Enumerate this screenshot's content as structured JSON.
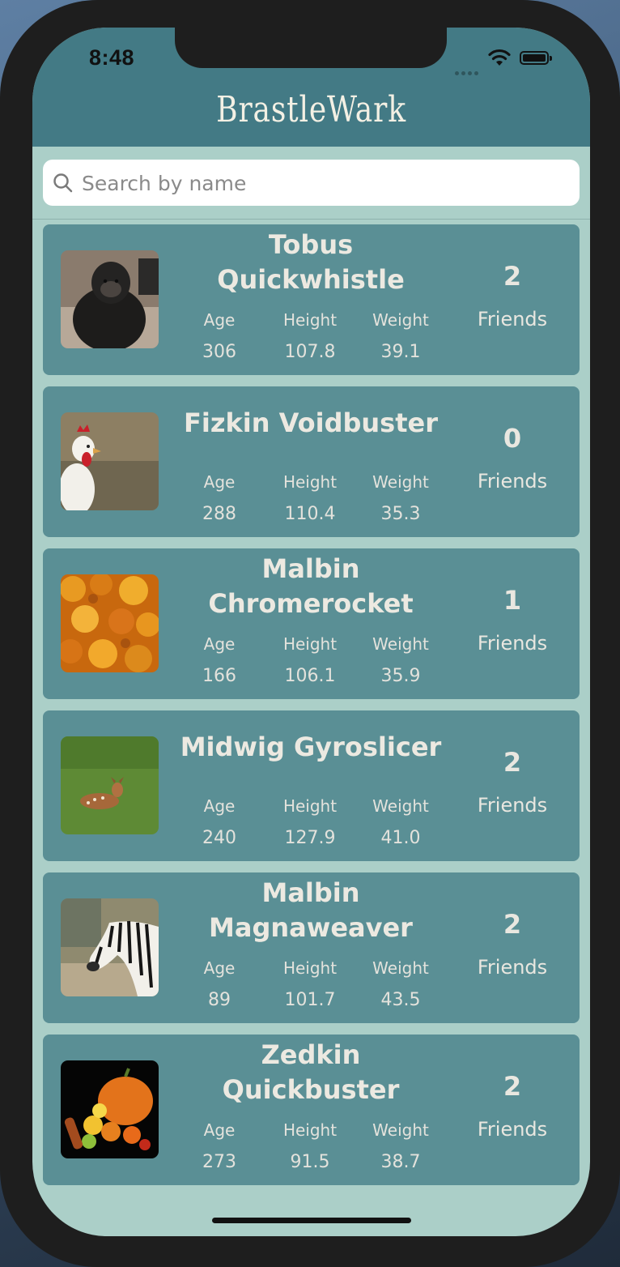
{
  "status_bar": {
    "time": "8:48"
  },
  "header": {
    "title": "BrastleWark"
  },
  "search": {
    "placeholder": "Search by name",
    "value": ""
  },
  "labels": {
    "age": "Age",
    "height": "Height",
    "weight": "Weight",
    "friends": "Friends"
  },
  "gnomes": [
    {
      "name": "Tobus Quickwhistle",
      "age": "306",
      "height": "107.8",
      "weight": "39.1",
      "friends": "2",
      "image": "chimpanzee"
    },
    {
      "name": "Fizkin Voidbuster",
      "age": "288",
      "height": "110.4",
      "weight": "35.3",
      "friends": "0",
      "image": "rooster"
    },
    {
      "name": "Malbin Chromerocket",
      "age": "166",
      "height": "106.1",
      "weight": "35.9",
      "friends": "1",
      "image": "autumn-leaves"
    },
    {
      "name": "Midwig Gyroslicer",
      "age": "240",
      "height": "127.9",
      "weight": "41.0",
      "friends": "2",
      "image": "fawn-on-grass"
    },
    {
      "name": "Malbin Magnaweaver",
      "age": "89",
      "height": "101.7",
      "weight": "43.5",
      "friends": "2",
      "image": "zebra"
    },
    {
      "name": "Zedkin Quickbuster",
      "age": "273",
      "height": "91.5",
      "weight": "38.7",
      "friends": "2",
      "image": "pumpkin-and-fruit"
    }
  ]
}
